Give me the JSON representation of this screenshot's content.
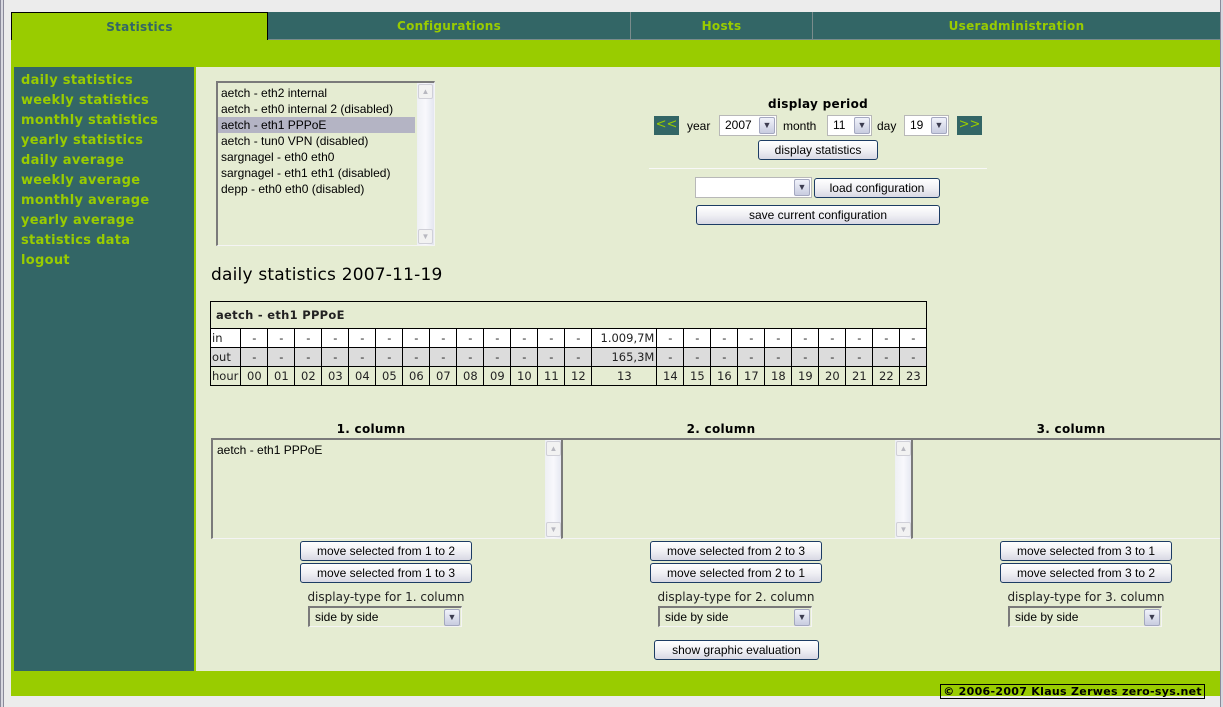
{
  "tabs": [
    {
      "label": "Statistics",
      "active": true
    },
    {
      "label": "Configurations",
      "active": false
    },
    {
      "label": "Hosts",
      "active": false
    },
    {
      "label": "Useradministration",
      "active": false
    }
  ],
  "sidebar": {
    "items": [
      {
        "label": "daily statistics"
      },
      {
        "label": "weekly statistics"
      },
      {
        "label": "monthly statistics"
      },
      {
        "label": "yearly statistics"
      },
      {
        "label": "daily average"
      },
      {
        "label": "weekly average"
      },
      {
        "label": "monthly average"
      },
      {
        "label": "yearly average"
      },
      {
        "label": "statistics data"
      },
      {
        "label": "logout"
      }
    ]
  },
  "interfaces": {
    "options": [
      {
        "label": "aetch - eth2 internal",
        "selected": false
      },
      {
        "label": "aetch - eth0 internal 2 (disabled)",
        "selected": false
      },
      {
        "label": "aetch - eth1 PPPoE",
        "selected": true
      },
      {
        "label": "aetch - tun0 VPN (disabled)",
        "selected": false
      },
      {
        "label": "sargnagel - eth0 eth0",
        "selected": false
      },
      {
        "label": "sargnagel - eth1 eth1 (disabled)",
        "selected": false
      },
      {
        "label": "depp - eth0 eth0 (disabled)",
        "selected": false
      }
    ]
  },
  "period": {
    "title": "display period",
    "prev": "<<",
    "next": ">>",
    "year_label": "year",
    "year": "2007",
    "month_label": "month",
    "month": "11",
    "day_label": "day",
    "day": "19",
    "display_button": "display statistics"
  },
  "config": {
    "selected": "",
    "load_button": "load configuration",
    "save_button": "save current configuration"
  },
  "stats": {
    "heading": "daily statistics 2007-11-19",
    "caption": "aetch - eth1 PPPoE",
    "row_labels": {
      "in": "in",
      "out": "out",
      "hour": "hour"
    },
    "hours": [
      "00",
      "01",
      "02",
      "03",
      "04",
      "05",
      "06",
      "07",
      "08",
      "09",
      "10",
      "11",
      "12",
      "13",
      "14",
      "15",
      "16",
      "17",
      "18",
      "19",
      "20",
      "21",
      "22",
      "23"
    ],
    "in": [
      "-",
      "-",
      "-",
      "-",
      "-",
      "-",
      "-",
      "-",
      "-",
      "-",
      "-",
      "-",
      "-",
      "1.009,7M",
      "-",
      "-",
      "-",
      "-",
      "-",
      "-",
      "-",
      "-",
      "-",
      "-"
    ],
    "out": [
      "-",
      "-",
      "-",
      "-",
      "-",
      "-",
      "-",
      "-",
      "-",
      "-",
      "-",
      "-",
      "-",
      "165,3M",
      "-",
      "-",
      "-",
      "-",
      "-",
      "-",
      "-",
      "-",
      "-",
      "-"
    ]
  },
  "columns": [
    {
      "title": "1. column",
      "items": [
        "aetch - eth1 PPPoE"
      ],
      "buttons": [
        "move selected from 1 to 2",
        "move selected from 1 to 3"
      ],
      "display_type_label": "display-type for 1. column",
      "display_type": "side by side"
    },
    {
      "title": "2. column",
      "items": [],
      "buttons": [
        "move selected from 2 to 3",
        "move selected from 2 to 1"
      ],
      "display_type_label": "display-type for 2. column",
      "display_type": "side by side"
    },
    {
      "title": "3. column",
      "items": [],
      "buttons": [
        "move selected from 3 to 1",
        "move selected from 3 to 2"
      ],
      "display_type_label": "display-type for 3. column",
      "display_type": "side by side"
    }
  ],
  "graphic_button": "show graphic evaluation",
  "footer": {
    "copyright": "© 2006-2007 Klaus Zerwes zero-sys.net"
  },
  "colors": {
    "brand_green": "#99cc00",
    "brand_teal": "#336666",
    "content_bg": "#e5ecd2"
  }
}
